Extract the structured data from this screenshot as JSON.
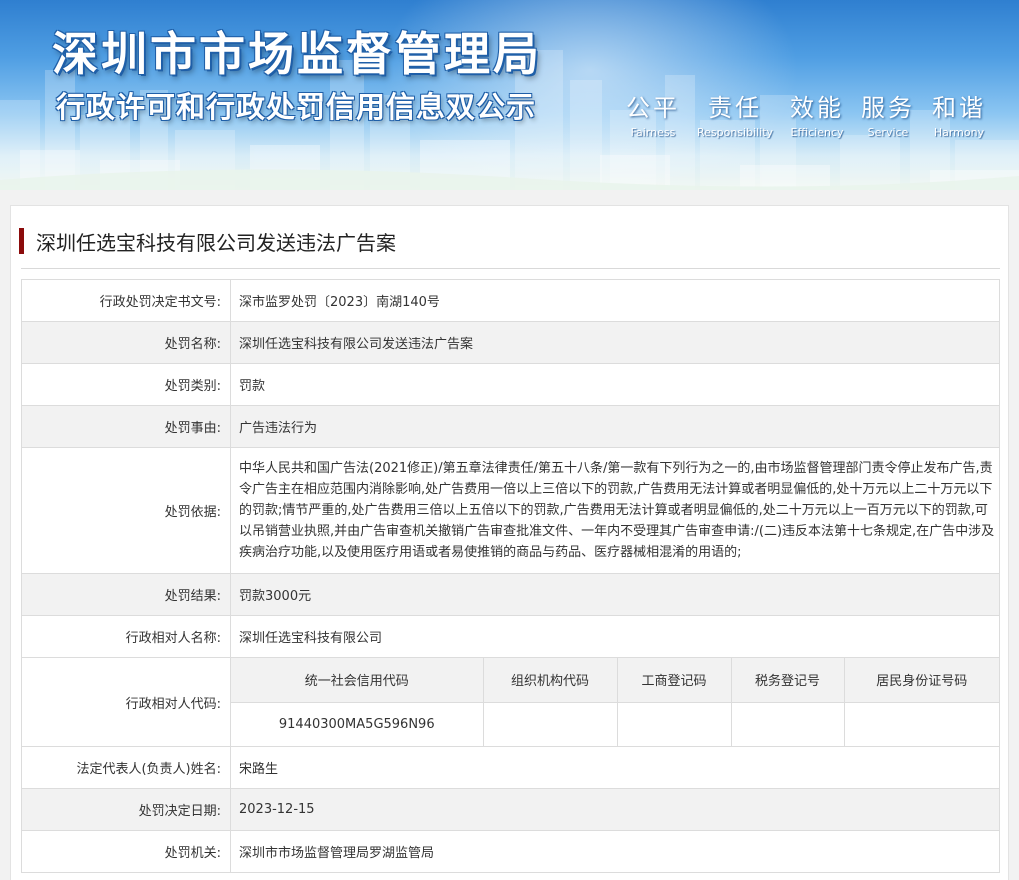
{
  "banner": {
    "title": "深圳市市场监督管理局",
    "subtitle": "行政许可和行政处罚信用信息双公示",
    "slogans": [
      {
        "cn": "公平",
        "en": "Fairness"
      },
      {
        "cn": "责任",
        "en": "Responsibility"
      },
      {
        "cn": "效能",
        "en": "Efficiency"
      },
      {
        "cn": "服务",
        "en": "Service"
      },
      {
        "cn": "和谐",
        "en": "Harmony"
      }
    ]
  },
  "case_title": "深圳任选宝科技有限公司发送违法广告案",
  "fields": {
    "doc_no": {
      "label": "行政处罚决定书文号:",
      "value": "深市监罗处罚〔2023〕南湖140号"
    },
    "penalty_name": {
      "label": "处罚名称:",
      "value": "深圳任选宝科技有限公司发送违法广告案"
    },
    "penalty_type": {
      "label": "处罚类别:",
      "value": "罚款"
    },
    "penalty_reason": {
      "label": "处罚事由:",
      "value": "广告违法行为"
    },
    "penalty_basis": {
      "label": "处罚依据:",
      "value": "中华人民共和国广告法(2021修正)/第五章法律责任/第五十八条/第一款有下列行为之一的,由市场监督管理部门责令停止发布广告,责令广告主在相应范围内消除影响,处广告费用一倍以上三倍以下的罚款,广告费用无法计算或者明显偏低的,处十万元以上二十万元以下的罚款;情节严重的,处广告费用三倍以上五倍以下的罚款,广告费用无法计算或者明显偏低的,处二十万元以上一百万元以下的罚款,可以吊销营业执照,并由广告审查机关撤销广告审查批准文件、一年内不受理其广告审查申请:/(二)违反本法第十七条规定,在广告中涉及疾病治疗功能,以及使用医疗用语或者易使推销的商品与药品、医疗器械相混淆的用语的;"
    },
    "penalty_result": {
      "label": "处罚结果:",
      "value": "罚款3000元"
    },
    "counterpart_name": {
      "label": "行政相对人名称:",
      "value": "深圳任选宝科技有限公司"
    },
    "counterpart_code": {
      "label": "行政相对人代码:",
      "headers": [
        "统一社会信用代码",
        "组织机构代码",
        "工商登记码",
        "税务登记号",
        "居民身份证号码"
      ],
      "values": [
        "91440300MA5G596N96",
        "",
        "",
        "",
        ""
      ]
    },
    "legal_rep": {
      "label": "法定代表人(负责人)姓名:",
      "value": "宋路生"
    },
    "decision_date": {
      "label": "处罚决定日期:",
      "value": "2023-12-15"
    },
    "authority": {
      "label": "处罚机关:",
      "value": "深圳市市场监督管理局罗湖监管局"
    }
  },
  "colors": {
    "title_accent": "#8b0b0b",
    "banner_top": "#2f7fd0",
    "row_alt": "#f2f2f2"
  }
}
